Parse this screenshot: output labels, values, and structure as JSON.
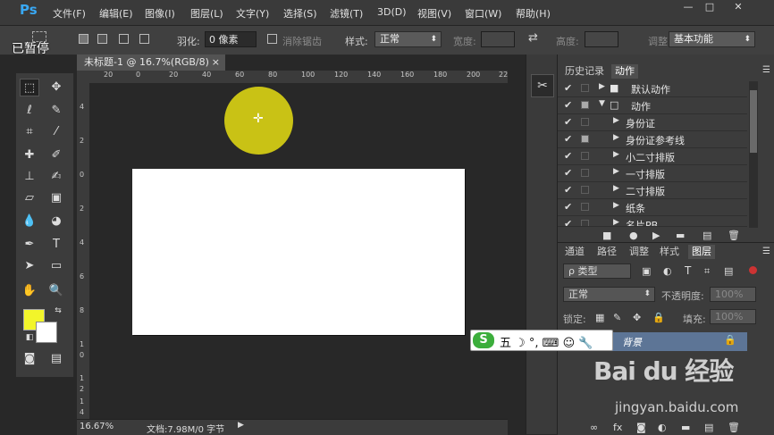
{
  "app": {
    "logo": "Ps",
    "paused_label": "已暂停"
  },
  "menu": [
    "文件(F)",
    "编辑(E)",
    "图像(I)",
    "图层(L)",
    "文字(Y)",
    "选择(S)",
    "滤镜(T)",
    "3D(D)",
    "视图(V)",
    "窗口(W)",
    "帮助(H)"
  ],
  "window_controls": {
    "minimize": "—",
    "restore": "□",
    "close": "✕"
  },
  "options": {
    "feather_label": "羽化:",
    "feather_value": "0 像素",
    "antialias_label": "消除锯齿",
    "style_label": "样式:",
    "style_value": "正常",
    "width_label": "宽度:",
    "height_label": "高度:",
    "refine_label": "调整",
    "workspace_value": "基本功能"
  },
  "document": {
    "tab_title": "未标题-1 @ 16.7%(RGB/8)",
    "tab_close": "×",
    "zoom": "16.67%",
    "doc_info": "文档:7.98M/0 字节"
  },
  "ruler_top": [
    "20",
    "0",
    "20",
    "40",
    "60",
    "80",
    "100",
    "120",
    "140",
    "160",
    "180",
    "200",
    "22"
  ],
  "ruler_left": [
    "4",
    "2",
    "0",
    "2",
    "4",
    "6",
    "8",
    "1",
    "0",
    "1",
    "2",
    "1",
    "4"
  ],
  "colors": {
    "foreground": "#f2f52a",
    "background": "#ffffff",
    "circle": "#c9c215",
    "layer_highlight": "#5d7596"
  },
  "actions_panel": {
    "tabs": [
      "历史记录",
      "动作"
    ],
    "rows": [
      {
        "label": "默认动作",
        "level": 0,
        "type": "folder"
      },
      {
        "label": "动作",
        "level": 0,
        "type": "folder-open"
      },
      {
        "label": "身份证",
        "level": 1
      },
      {
        "label": "身份证参考线",
        "level": 1
      },
      {
        "label": "小二寸排版",
        "level": 1
      },
      {
        "label": "一寸排版",
        "level": 1
      },
      {
        "label": "二寸排版",
        "level": 1
      },
      {
        "label": "纸条",
        "level": 1
      },
      {
        "label": "名片PB",
        "level": 1
      }
    ]
  },
  "layers_panel": {
    "tabs": [
      "通道",
      "路径",
      "调整",
      "样式",
      "图层"
    ],
    "filter_label": "ρ 类型",
    "blend_mode": "正常",
    "opacity_label": "不透明度:",
    "opacity_value": "100%",
    "lock_label": "锁定:",
    "fill_label": "填充:",
    "fill_value": "100%",
    "layer_name": "背景"
  },
  "ime": {
    "logo": "S",
    "text": "五 ☽ °, ⌨ ☺ 🔧"
  },
  "watermark": {
    "brand": "Bai du 经验",
    "url": "jingyan.baidu.com"
  }
}
